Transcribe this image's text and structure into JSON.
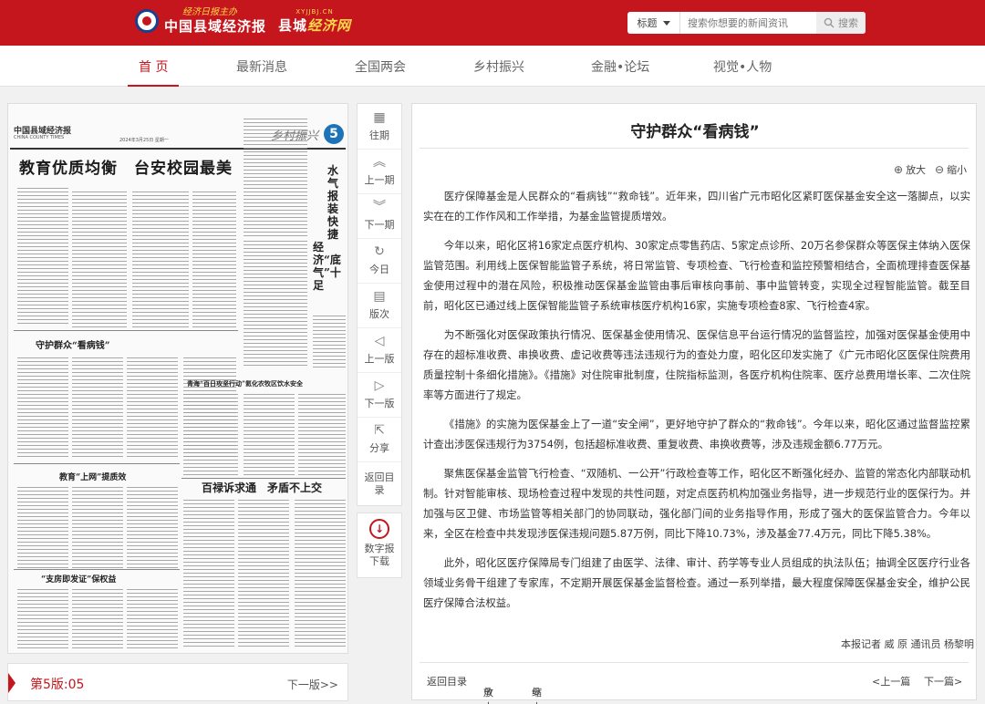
{
  "header": {
    "logo1_small": "经济日报主办",
    "logo1_name": "中国县域经济报",
    "logo2_url": "XYJJBJ.CN",
    "logo2_name_a": "县城",
    "logo2_name_b": "经济网",
    "search_type": "标题",
    "search_placeholder": "搜索你想要的新闻资讯",
    "search_button": "搜索",
    "brand_color": "#c4161c"
  },
  "nav": [
    "首 页",
    "最新消息",
    "全国两会",
    "乡村振兴",
    "金融•论坛",
    "视觉•人物"
  ],
  "paper": {
    "masthead": "中国县域经济报",
    "masthead_en": "CHINA COUNTY TIMES",
    "date": "2024年3月25日 星期一",
    "section": "乡村振兴",
    "page_number": "5",
    "headline_main": "教育优质均衡　台安校园最美",
    "headline_vertical": "水气报装快捷",
    "headline_vertical2": "经济“底气”十足",
    "headline_guard": "守护群众“看病钱”",
    "headline_qingming": "青海“百日攻坚行动”氦化农牧区饮水安全",
    "headline_edu": "教育“上网”提质效",
    "headline_baiji": "百禄诉求通　矛盾不上交",
    "headline_finance": "“支房即发证”保权益",
    "current_page": "第5版:05",
    "next_page": "下一版>>"
  },
  "tools": [
    {
      "icon": "calendar-icon",
      "label": "往期"
    },
    {
      "icon": "double-up-icon",
      "label": "上一期"
    },
    {
      "icon": "double-down-icon",
      "label": "下一期"
    },
    {
      "icon": "refresh-icon",
      "label": "今日"
    },
    {
      "icon": "layout-icon",
      "label": "版次"
    },
    {
      "icon": "circle-left-icon",
      "label": "上一版"
    },
    {
      "icon": "circle-right-icon",
      "label": "下一版"
    },
    {
      "icon": "share-icon",
      "label": "分享"
    },
    {
      "icon": "",
      "label": "返回目录"
    }
  ],
  "download": "数字报下载",
  "article": {
    "title": "守护群众“看病钱”",
    "zoom_in": "放大",
    "zoom_out": "缩小",
    "paragraphs": [
      "医疗保障基金是人民群众的“看病钱”“救命钱”。近年来，四川省广元市昭化区紧盯医保基金安全这一落脚点，以实实在在的工作作风和工作举措，为基金监管提质增效。",
      "今年以来，昭化区将16家定点医疗机构、30家定点零售药店、5家定点诊所、20万名参保群众等医保主体纳入医保监管范围。利用线上医保智能监管子系统，将日常监管、专项检查、飞行检查和监控预警相结合，全面梳理排查医保基金使用过程中的潜在风险，积极推动医保基金监管由事后审核向事前、事中监管转变，实现全过程智能监管。截至目前，昭化区已通过线上医保智能监管子系统审核医疗机构16家，实施专项检查8家、飞行检查4家。",
      "为不断强化对医保政策执行情况、医保基金使用情况、医保信息平台运行情况的监督监控，加强对医保基金使用中存在的超标准收费、串换收费、虚记收费等违法违规行为的查处力度，昭化区印发实施了《广元市昭化区医保住院费用质量控制十条细化措施》。《措施》对住院审批制度，住院指标监测，各医疗机构住院率、医疗总费用增长率、二次住院率等方面进行了规定。",
      "《措施》的实施为医保基金上了一道“安全闸”，更好地守护了群众的“救命钱”。今年以来，昭化区通过监督监控累计查出涉医保违规行为3754例，包括超标准收费、重复收费、串换收费等，涉及违规金额6.77万元。",
      "聚焦医保基金监管飞行检查、“双随机、一公开”行政检查等工作，昭化区不断强化经办、监管的常态化内部联动机制。针对智能审核、现场检查过程中发现的共性问题，对定点医药机构加强业务指导，进一步规范行业的医保行为。并加强与区卫健、市场监管等相关部门的协同联动，强化部门间的业务指导作用，形成了强大的医保监管合力。今年以来，全区在检查中共发现涉医保违规问题5.87万例，同比下降10.73%，涉及基金77.4万元，同比下降5.38%。",
      "此外，昭化区医疗保障局专门组建了由医学、法律、审计、药学等专业人员组成的执法队伍；抽调全区医疗行业各领域业务骨干组建了专家库，不定期开展医保基金监督检查。通过一系列举措，最大程度保障医保基金安全，维护公民医疗保障合法权益。"
    ],
    "author": "本报记者 威 原 通讯员 杨黎明",
    "footer": {
      "back": "返回目录",
      "zoom_in": "放大",
      "zoom_out": "缩小",
      "prev": "<上一篇",
      "next": "下一篇>"
    }
  }
}
